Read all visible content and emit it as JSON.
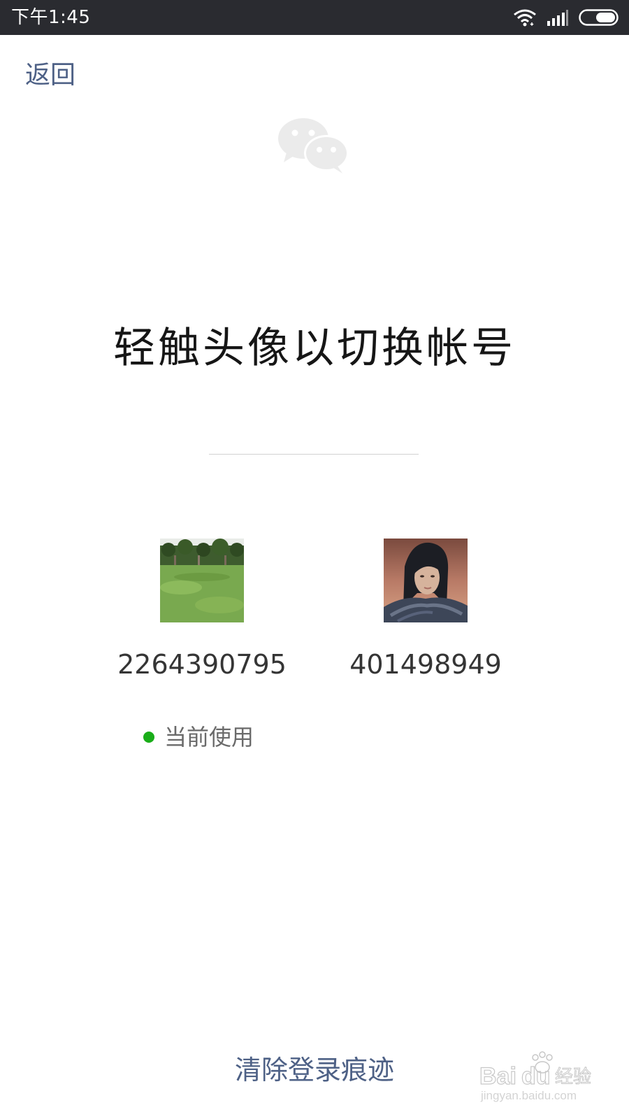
{
  "status_bar": {
    "time": "下午1:45",
    "icons": [
      "wifi-icon",
      "signal-icon",
      "battery-icon"
    ]
  },
  "nav": {
    "back_label": "返回"
  },
  "logo": {
    "icon": "wechat-logo-icon",
    "color": "#eaeaea"
  },
  "title": "轻触头像以切换帐号",
  "accounts": [
    {
      "number": "2264390795",
      "avatar": "grass-field-photo",
      "current": true
    },
    {
      "number": "401498949",
      "avatar": "dark-haired-character-portrait",
      "current": false
    }
  ],
  "current_label": "当前使用",
  "current_dot_color": "#1aad19",
  "clear_label": "清除登录痕迹",
  "link_color": "#4e6186",
  "watermark": {
    "brand": "Baidu经验",
    "url": "jingyan.baidu.com"
  }
}
